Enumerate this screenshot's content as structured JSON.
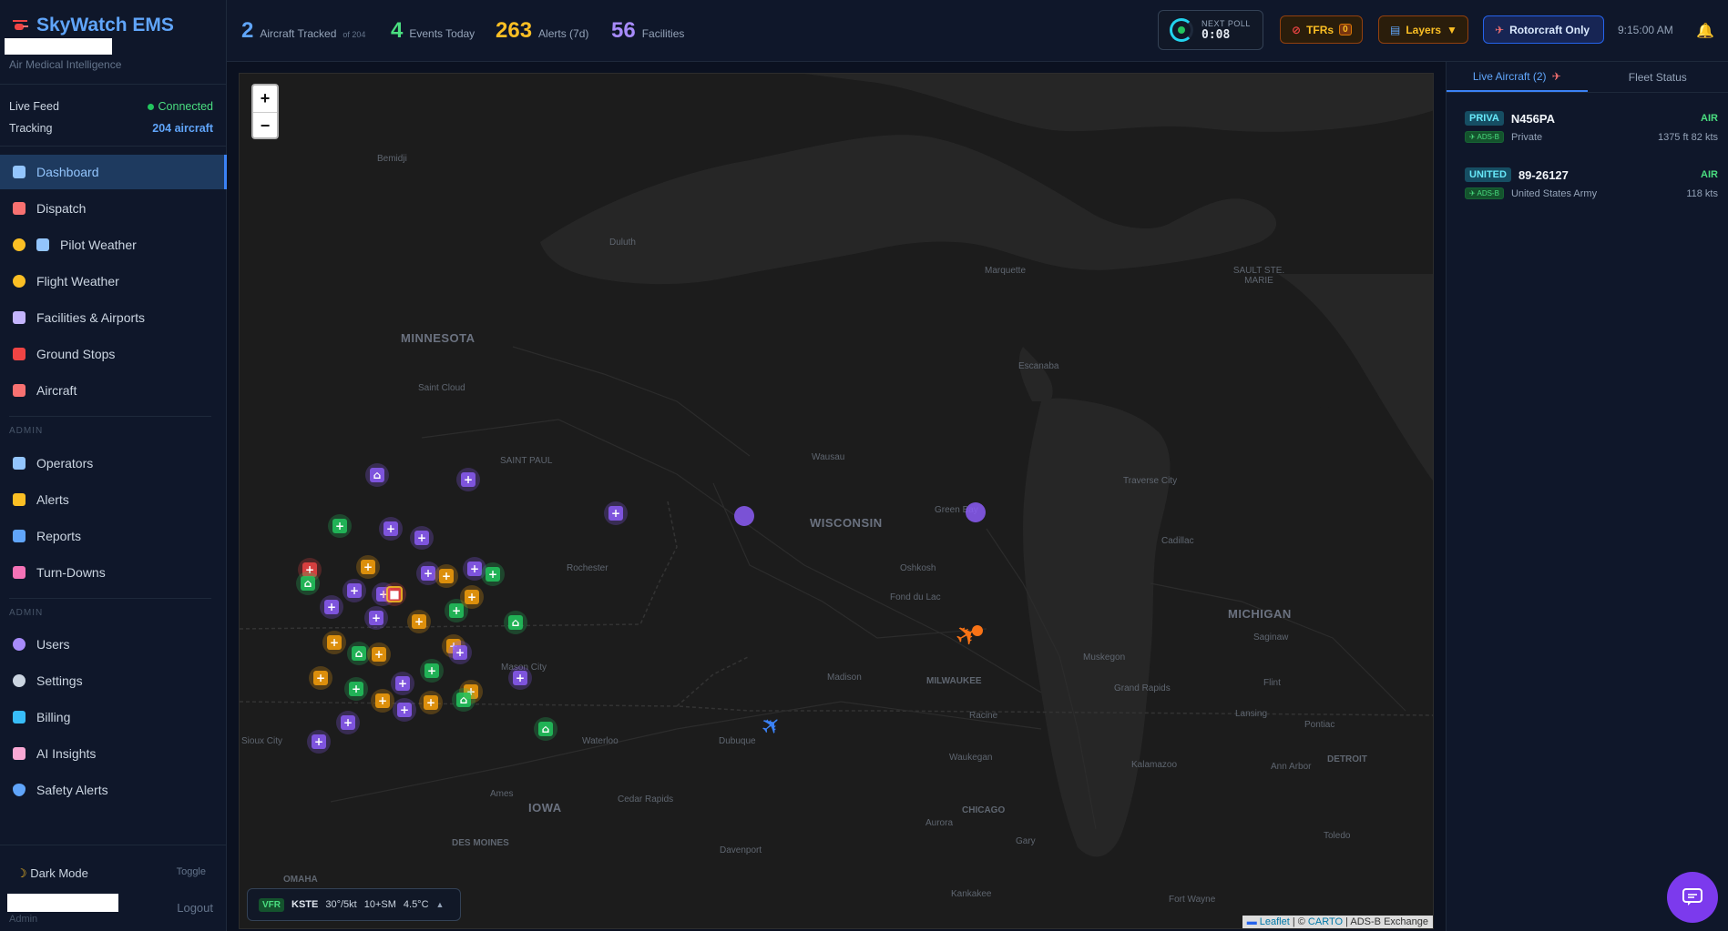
{
  "brand": {
    "title": "SkyWatch EMS",
    "subtitle": "Air Medical Intelligence"
  },
  "status": {
    "live_feed_label": "Live Feed",
    "live_feed_value": "Connected",
    "tracking_label": "Tracking",
    "tracking_value": "204 aircraft"
  },
  "nav": {
    "main": [
      "Dashboard",
      "Dispatch",
      "Pilot Weather",
      "Flight Weather",
      "Facilities & Airports",
      "Ground Stops",
      "Aircraft"
    ],
    "admin_label_1": "ADMIN",
    "admin1": [
      "Operators",
      "Alerts",
      "Reports",
      "Turn-Downs"
    ],
    "admin_label_2": "ADMIN",
    "admin2": [
      "Users",
      "Settings",
      "Billing",
      "AI Insights",
      "Safety Alerts"
    ]
  },
  "footer": {
    "dark_mode": "Dark Mode",
    "toggle": "Toggle",
    "logout": "Logout",
    "role": "Admin"
  },
  "stats": {
    "aircraft_num": "2",
    "aircraft_label": "Aircraft Tracked",
    "aircraft_sub": "of 204",
    "events_num": "4",
    "events_label": "Events Today",
    "alerts_num": "263",
    "alerts_label": "Alerts (7d)",
    "facilities_num": "56",
    "facilities_label": "Facilities"
  },
  "poll": {
    "label": "NEXT POLL",
    "time": "0:08"
  },
  "controls": {
    "tfrs": "TFRs",
    "tfr_count": "0",
    "layers": "Layers",
    "rotorcraft": "Rotorcraft Only",
    "time": "9:15:00 AM"
  },
  "map": {
    "zoom_in": "+",
    "zoom_out": "−",
    "regions": [
      "MINNESOTA",
      "WISCONSIN",
      "MICHIGAN",
      "IOWA"
    ],
    "cities": [
      "Bemidji",
      "Duluth",
      "Marquette",
      "SAULT STE. MARIE",
      "Escanaba",
      "Saint Cloud",
      "SAINT PAUL",
      "Wausau",
      "Traverse City",
      "Green Bay",
      "Cadillac",
      "Rochester",
      "Oshkosh",
      "Fond du Lac",
      "Saginaw",
      "Mason City",
      "Madison",
      "MILWAUKEE",
      "Muskegon",
      "Grand Rapids",
      "Flint",
      "Lansing",
      "Pontiac",
      "Sioux City",
      "Waterloo",
      "Dubuque",
      "Racine",
      "Waukegan",
      "Kalamazoo",
      "Ann Arbor",
      "DETROIT",
      "Ames",
      "Cedar Rapids",
      "Aurora",
      "CHICAGO",
      "DES MOINES",
      "Davenport",
      "Gary",
      "Toledo",
      "OMAHA",
      "Kankakee",
      "Fort Wayne"
    ],
    "weather": {
      "category": "VFR",
      "station": "KSTE",
      "wind": "30°/5kt",
      "vis": "10+SM",
      "temp": "4.5°C"
    },
    "attribution": {
      "leaflet": "Leaflet",
      "sep": " | © ",
      "carto": "CARTO",
      "adsb": " | ADS-B Exchange"
    }
  },
  "panel": {
    "tab_live": "Live Aircraft (2)",
    "tab_fleet": "Fleet Status",
    "aircraft": [
      {
        "tag": "PRIVA",
        "reg": "N456PA",
        "status": "AIR",
        "source": "ADS-B",
        "operator": "Private",
        "perf": "1375 ft 82 kts"
      },
      {
        "tag": "UNITED",
        "reg": "89-26127",
        "status": "AIR",
        "source": "ADS-B",
        "operator": "United States Army",
        "perf": "118 kts"
      }
    ]
  },
  "colors": {
    "accent": "#3b82f6",
    "hospital_green": "#22c55e",
    "heliport_purple": "#8b5cf6",
    "facility_orange": "#f59e0b",
    "alert_red": "#ef4444"
  }
}
